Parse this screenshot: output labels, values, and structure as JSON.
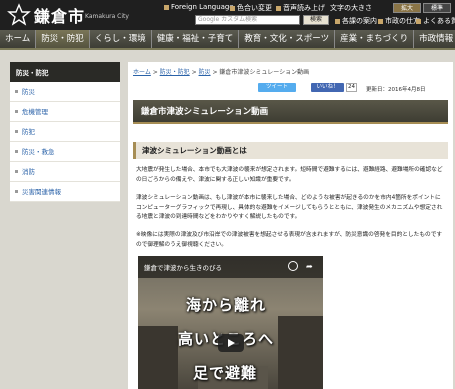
{
  "header": {
    "site_title": "鎌倉市",
    "site_sub": "Kamakura City",
    "links": [
      "Foreign Language",
      "色合い変更",
      "音声読み上げ",
      "文字の大きさ",
      "拡大",
      "標準"
    ],
    "search_placeholder": "Google カスタム検索",
    "search_button": "検索",
    "links2": [
      "各課の案内",
      "市政の仕方",
      "よくある質問"
    ]
  },
  "nav": {
    "items": [
      "ホーム",
      "防災・防犯",
      "くらし・環境",
      "健康・福祉・子育て",
      "教育・文化・スポーツ",
      "産業・まちづくり",
      "市政情報"
    ]
  },
  "sidebar": {
    "heading": "防災・防犯",
    "items": [
      "防災",
      "危機管理",
      "防犯",
      "防災・救急",
      "消防",
      "災害関連情報"
    ]
  },
  "main": {
    "breadcrumb": {
      "home": "ホーム",
      "sep": " > ",
      "c1": "防災・防犯",
      "c2": "防災",
      "current": "鎌倉市津波シミュレーション動画"
    },
    "tweet": "ツイート",
    "like": "いいね！",
    "like_count": "24",
    "updated": "更新日：2016年4月8日",
    "title": "鎌倉市津波シミュレーション動画",
    "subhead": "津波シミュレーション動画とは",
    "p1": "大地震が発生した場合、本市でも大津波の襲来が想定されます。短時間で避難するには、避難経路、避難場所の確認などの日ごろからの備えや、津波に関する正しい知識が重要です。",
    "p2": "津波シミュレーション動画は、もし津波が本市に襲来した場合、どのような被害が起きるのかを市内4箇所をポイントにコンピューターグラフィックで再現し、具体的な避難をイメージしてもらうとともに、津波発生のメカニズムや想定される地震と津波の到達時間などをわかりやすく解説したものです。",
    "p3": "※映像には実際の津波及び市沿岸での津波被害を想起させる表現が含まれますが、防災意識の啓発を目的としたものですので御理解のうえ御視聴ください。",
    "video": {
      "title": "鎌倉で津波から生きのびる",
      "line1": "海から離れ",
      "line2": "高いところへ",
      "line3": "足で避難"
    }
  }
}
